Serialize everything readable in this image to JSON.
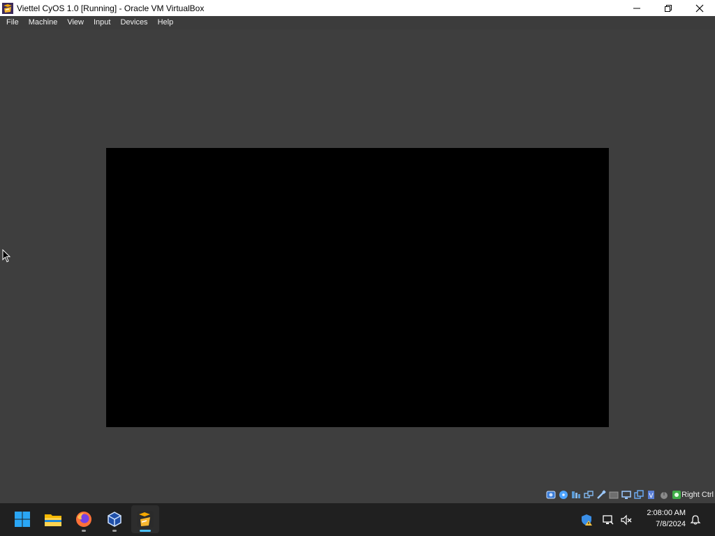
{
  "window": {
    "title": "Viettel CyOS 1.0 [Running] - Oracle VM VirtualBox",
    "icon": "virtualbox-vm-icon",
    "controls": [
      "minimize-icon",
      "restore-icon",
      "close-icon"
    ]
  },
  "menu": {
    "items": [
      {
        "label": "File"
      },
      {
        "label": "Machine"
      },
      {
        "label": "View"
      },
      {
        "label": "Input"
      },
      {
        "label": "Devices"
      },
      {
        "label": "Help"
      }
    ]
  },
  "vm_display": {
    "state": "blank",
    "screen_color": "#000000"
  },
  "statusbar": {
    "icons": [
      "hard-disk-icon",
      "optical-drive-icon",
      "audio-icon",
      "network-icon",
      "usb-icon",
      "shared-folders-icon",
      "display-icon",
      "video-capture-icon",
      "virtualization-icon",
      "mouse-integration-icon",
      "keyboard-icon"
    ],
    "host_key": "Right Ctrl"
  },
  "taskbar": {
    "apps": [
      {
        "name": "windows-start-icon",
        "running": false
      },
      {
        "name": "file-explorer-icon",
        "running": false
      },
      {
        "name": "firefox-icon",
        "running": true
      },
      {
        "name": "virtualbox-icon",
        "running": true
      },
      {
        "name": "virtualbox-vm-icon",
        "running": true,
        "active": true
      }
    ],
    "tray_icons": [
      "security-warning-icon",
      "network-icon",
      "volume-muted-icon"
    ],
    "time": "2:08:00 AM",
    "date": "7/8/2024",
    "notification_icon": "bell-icon"
  },
  "colors": {
    "accent": "#4cc2ff",
    "menubar_bg": "#3c3c3c",
    "taskbar_bg": "#202020"
  }
}
